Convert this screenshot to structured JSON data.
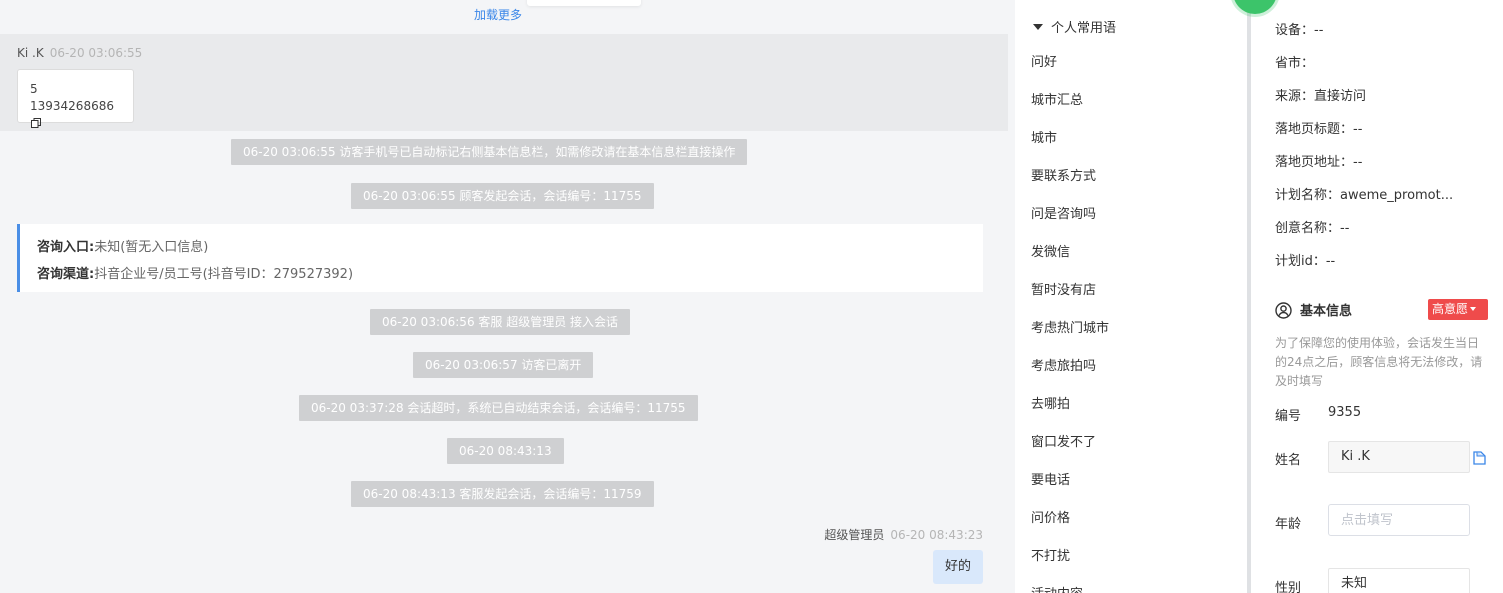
{
  "chat": {
    "load_more": "加载更多",
    "visitor": {
      "name": "Ki .K",
      "time": "06-20 03:06:55",
      "bubble_line1": "5",
      "bubble_line2": "13934268686"
    },
    "system_messages": [
      "06-20 03:06:55 访客手机号已自动标记右侧基本信息栏，如需修改请在基本信息栏直接操作",
      "06-20 03:06:55 顾客发起会话，会话编号：11755",
      "06-20 03:06:56 客服 超级管理员 接入会话",
      "06-20 03:06:57 访客已离开",
      "06-20 03:37:28 会话超时，系统已自动结束会话，会话编号：11755",
      "06-20 08:43:13",
      "06-20 08:43:13 客服发起会话，会话编号：11759"
    ],
    "consult_card": {
      "entry_label": "咨询入口:",
      "entry_value": "未知(暂无入口信息)",
      "channel_label": "咨询渠道:",
      "channel_value": "抖音企业号/员工号(抖音号ID：279527392)"
    },
    "agent": {
      "name": "超级管理员",
      "time": "06-20 08:43:23",
      "message": "好的"
    }
  },
  "phrases": {
    "header": "个人常用语",
    "items": [
      "问好",
      "城市汇总",
      "城市",
      "要联系方式",
      "问是咨询吗",
      "发微信",
      "暂时没有店",
      "考虑热门城市",
      "考虑旅拍吗",
      "去哪拍",
      "窗口发不了",
      "要电话",
      "问价格",
      "不打扰",
      "活动内容"
    ]
  },
  "customer": {
    "device": "设备：--",
    "province": "省市：",
    "source": "来源：直接访问",
    "landing_title": "落地页标题：--",
    "landing_url": "落地页地址：--",
    "plan_name": "计划名称：aweme_promot...",
    "creative_name": "创意名称：--",
    "plan_id": "计划id：--",
    "basic_info_title": "基本信息",
    "intent_badge": "高意愿",
    "hint": "为了保障您的使用体验，会话发生当日的24点之后，顾客信息将无法修改，请及时填写",
    "id_label": "编号",
    "id_value": "9355",
    "name_label": "姓名",
    "name_value": "Ki .K",
    "age_label": "年龄",
    "age_placeholder": "点击填写",
    "gender_label": "性别",
    "gender_value": "未知"
  },
  "colors": {
    "accent_blue": "#3a86e8",
    "system_bubble": "#cfd0d2",
    "intent_red": "#ef4b4b",
    "agent_bubble": "#d9e8fb",
    "online_green": "#3cc46a"
  }
}
